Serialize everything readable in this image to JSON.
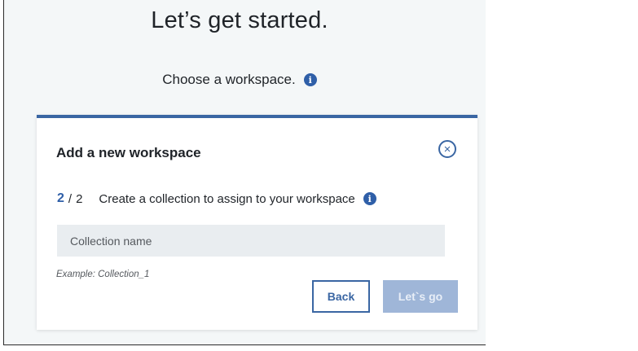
{
  "page": {
    "heading": "Let’s get started.",
    "subheading": "Choose a workspace.",
    "info_icon": "i"
  },
  "card": {
    "title": "Add a new workspace",
    "close_icon": "×",
    "step": {
      "current": "2",
      "separator": "/",
      "total": "2",
      "description": "Create a collection to assign to your workspace",
      "info_icon": "i"
    },
    "collection_input": {
      "value": "",
      "placeholder": "Collection name"
    },
    "example": "Example: Collection_1",
    "back_label": "Back",
    "go_label": "Let`s go"
  },
  "colors": {
    "accent": "#3a66a3",
    "info_icon": "#2f5fa8",
    "disabled_button": "#9fb6d8",
    "input_bg": "#e9edf0",
    "page_bg": "#f4f7f8"
  },
  "icons": {
    "info": "info-icon",
    "close": "close-circle-icon"
  }
}
